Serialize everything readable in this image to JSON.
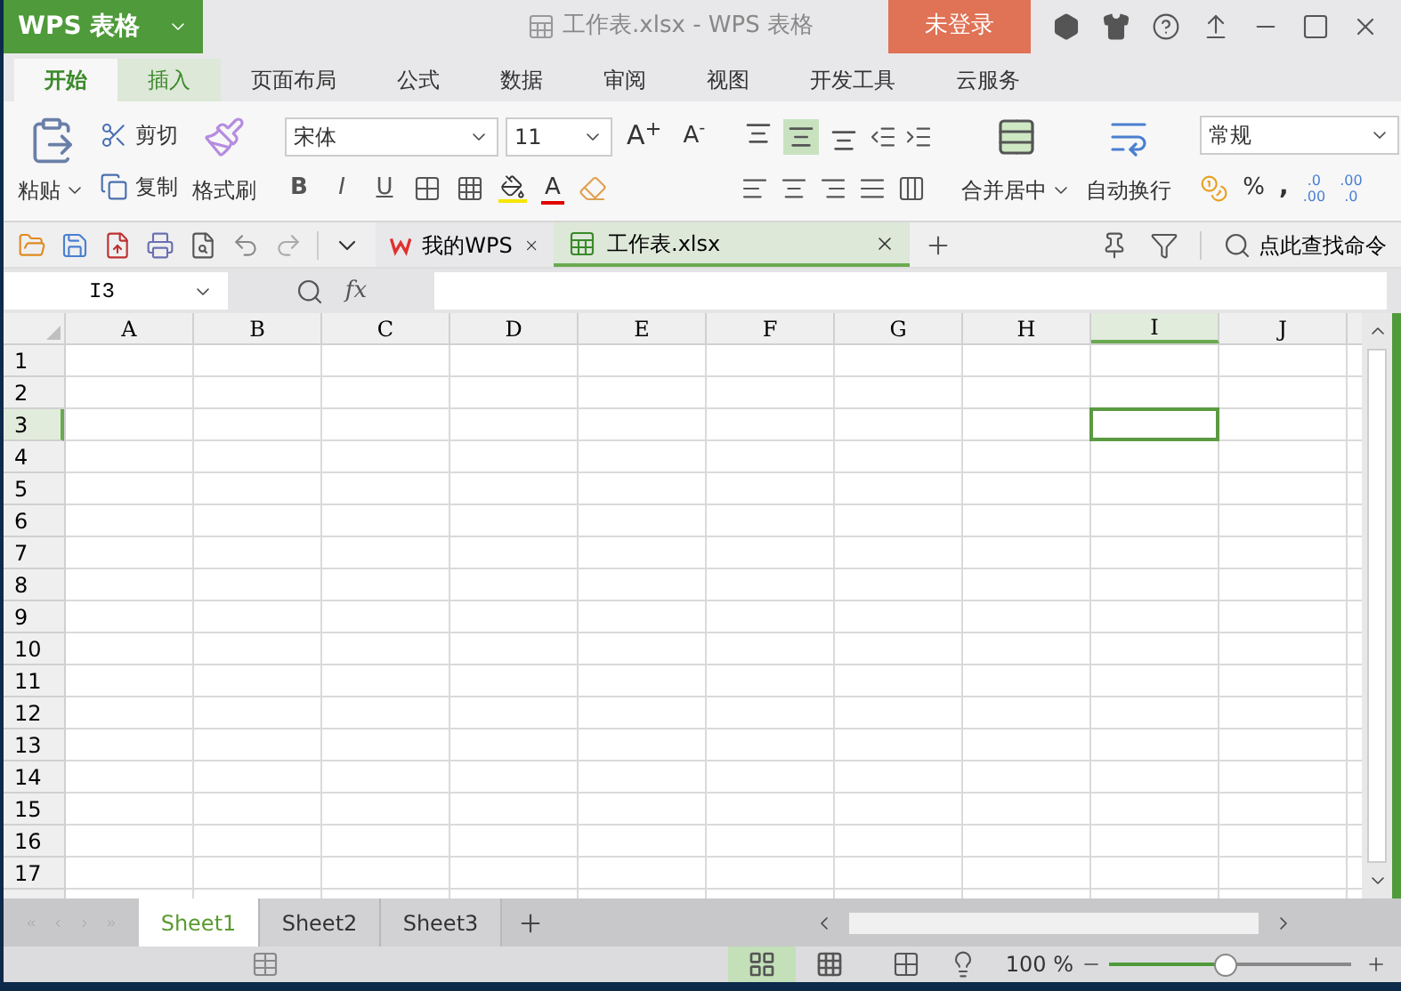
{
  "app": {
    "name": "WPS 表格",
    "document_title": "工作表.xlsx - WPS 表格",
    "login": "未登录"
  },
  "ribbon_tabs": [
    {
      "label": "开始",
      "selected": true,
      "hovered": false
    },
    {
      "label": "插入",
      "selected": false,
      "hovered": true
    },
    {
      "label": "页面布局",
      "selected": false,
      "hovered": false
    },
    {
      "label": "公式",
      "selected": false,
      "hovered": false
    },
    {
      "label": "数据",
      "selected": false,
      "hovered": false
    },
    {
      "label": "审阅",
      "selected": false,
      "hovered": false
    },
    {
      "label": "视图",
      "selected": false,
      "hovered": false
    },
    {
      "label": "开发工具",
      "selected": false,
      "hovered": false
    },
    {
      "label": "云服务",
      "selected": false,
      "hovered": false
    }
  ],
  "clipboard": {
    "paste": "粘贴",
    "cut": "剪切",
    "copy": "复制",
    "format_painter": "格式刷"
  },
  "font": {
    "name": "宋体",
    "size": "11",
    "grow": {
      "label": "A",
      "sign": "+"
    },
    "shrink": {
      "label": "A",
      "sign": "-"
    },
    "styles": [
      "B",
      "I",
      "U"
    ],
    "color_button": "A"
  },
  "alignment": [
    {
      "kind": "top",
      "selected": false
    },
    {
      "kind": "middle",
      "selected": true
    },
    {
      "kind": "bottom",
      "selected": false
    }
  ],
  "merge": "合并居中",
  "wrap": "自动换行",
  "number": {
    "format": "常规",
    "percent": "%",
    "comma": ",",
    "increase_decimal": [
      ".0",
      ".00"
    ],
    "decrease_decimal": [
      ".00",
      ".0"
    ]
  },
  "doc_tabs": [
    {
      "kind": "home",
      "label": "我的WPS",
      "selected": false
    },
    {
      "kind": "sheet",
      "label": "工作表.xlsx",
      "selected": true
    }
  ],
  "command_search": "点此查找命令",
  "formula_bar": {
    "name_box": "I3",
    "fx": "fx"
  },
  "columns": [
    {
      "label": "A",
      "selected": false
    },
    {
      "label": "B",
      "selected": false
    },
    {
      "label": "C",
      "selected": false
    },
    {
      "label": "D",
      "selected": false
    },
    {
      "label": "E",
      "selected": false
    },
    {
      "label": "F",
      "selected": false
    },
    {
      "label": "G",
      "selected": false
    },
    {
      "label": "H",
      "selected": false
    },
    {
      "label": "I",
      "selected": true
    },
    {
      "label": "J",
      "selected": false
    }
  ],
  "rows": [
    {
      "label": "1",
      "selected": false
    },
    {
      "label": "2",
      "selected": false
    },
    {
      "label": "3",
      "selected": true
    },
    {
      "label": "4",
      "selected": false
    },
    {
      "label": "5",
      "selected": false
    },
    {
      "label": "6",
      "selected": false
    },
    {
      "label": "7",
      "selected": false
    },
    {
      "label": "8",
      "selected": false
    },
    {
      "label": "9",
      "selected": false
    },
    {
      "label": "10",
      "selected": false
    },
    {
      "label": "11",
      "selected": false
    },
    {
      "label": "12",
      "selected": false
    },
    {
      "label": "13",
      "selected": false
    },
    {
      "label": "14",
      "selected": false
    },
    {
      "label": "15",
      "selected": false
    },
    {
      "label": "16",
      "selected": false
    },
    {
      "label": "17",
      "selected": false
    }
  ],
  "sheets": [
    {
      "label": "Sheet1",
      "selected": true
    },
    {
      "label": "Sheet2",
      "selected": false
    },
    {
      "label": "Sheet3",
      "selected": false
    }
  ],
  "status_bar": {
    "view_modes": [
      {
        "kind": "normal",
        "selected": true
      },
      {
        "kind": "page_break",
        "selected": false
      }
    ],
    "zoom": "100 %",
    "level": 0.48
  }
}
